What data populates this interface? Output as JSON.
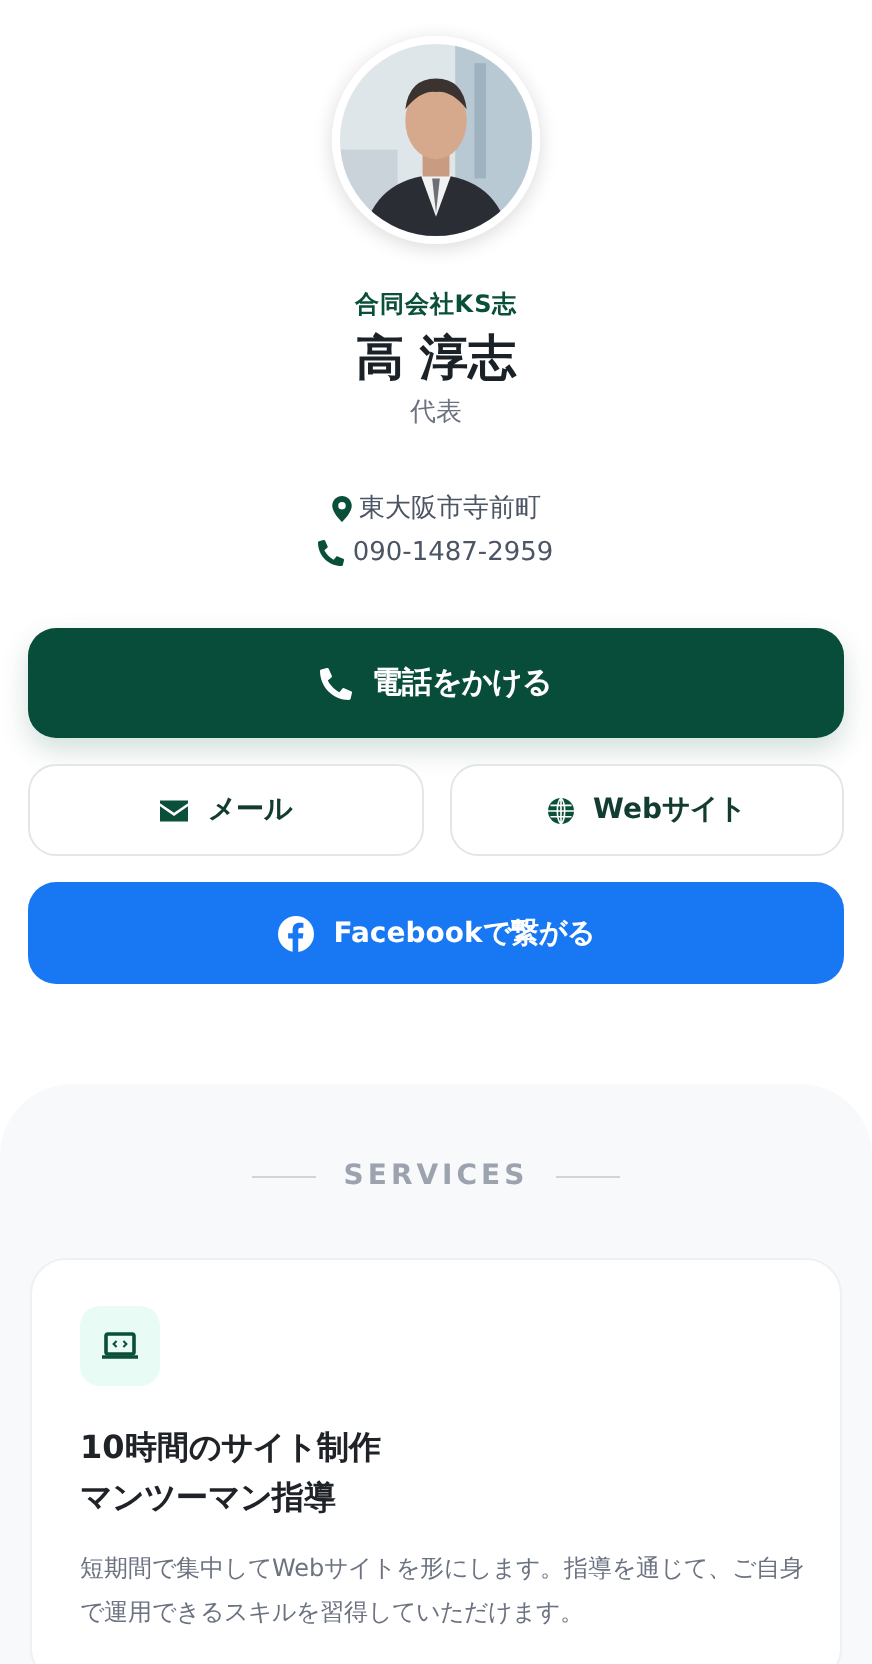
{
  "profile": {
    "company": "合同会社KS志",
    "name": "高 淳志",
    "role": "代表",
    "address": "東大阪市寺前町",
    "phone": "090-1487-2959"
  },
  "actions": [
    {
      "kind": "call",
      "label": "電話をかける"
    },
    {
      "kind": "mail",
      "label": "メール"
    },
    {
      "kind": "web",
      "label": "Webサイト"
    },
    {
      "kind": "facebook",
      "label": "Facebookで繋がる"
    }
  ],
  "services": {
    "heading": "SERVICES",
    "cards": [
      {
        "title_lines": [
          "10時間のサイト制作",
          "マンツーマン指導"
        ],
        "description": "短期間で集中してWebサイトを形にします。指導を通じて、ご自身で運用できるスキルを習得していただけます。"
      }
    ]
  }
}
